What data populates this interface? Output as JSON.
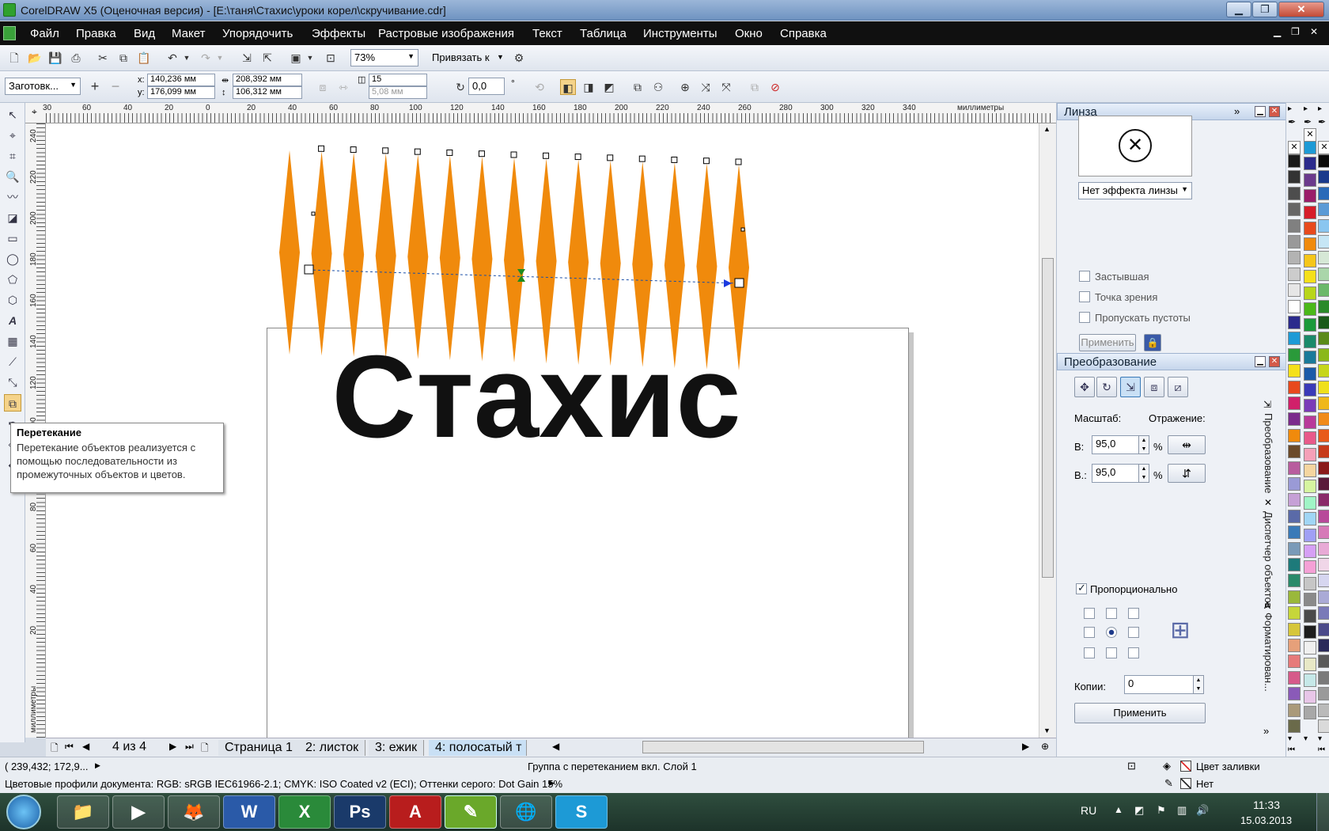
{
  "window": {
    "title": "CorelDRAW X5 (Оценочная версия) - [E:\\таня\\Стахис\\уроки корел\\скручивание.cdr]",
    "min": "▁",
    "max": "❐",
    "close": "✕"
  },
  "menu": [
    "Файл",
    "Правка",
    "Вид",
    "Макет",
    "Упорядочить",
    "Эффекты",
    "Растровые изображения",
    "Текст",
    "Таблица",
    "Инструменты",
    "Окно",
    "Справка"
  ],
  "standard_toolbar": {
    "zoom": "73%",
    "snap": "Привязать к"
  },
  "property_bar": {
    "preset": "Заготовк...",
    "x_label": "x:",
    "x": "140,236 мм",
    "y_label": "y:",
    "y": "176,099 мм",
    "w": "208,392 мм",
    "h": "106,312 мм",
    "steps": "15",
    "spacing": "5,08 мм",
    "angle": "0,0",
    "deg": "°"
  },
  "ruler_top_labels": [
    "30",
    "60",
    "40",
    "20",
    "0",
    "20",
    "40",
    "60",
    "80",
    "100",
    "120",
    "140",
    "160",
    "180",
    "200",
    "220",
    "240",
    "260",
    "280",
    "300",
    "320",
    "340",
    "миллиметры"
  ],
  "ruler_left_labels": [
    "240",
    "220",
    "200",
    "180",
    "160",
    "140",
    "120",
    "100",
    "80",
    "60",
    "40",
    "20",
    "миллиметры"
  ],
  "canvas": {
    "text": "Стахис",
    "fill": "#f08a0c",
    "text_color": "#111111"
  },
  "tooltip": {
    "title": "Перетекание",
    "body": "Перетекание объектов реализуется с помощью последовательности из промежуточных объектов и цветов."
  },
  "pages": {
    "counter": "4 из 4",
    "tabs": [
      "Страница 1",
      "2: листок",
      "3: ежик",
      "4: полосатый т"
    ]
  },
  "status": {
    "coords": "( 239,432; 172,9...",
    "object": "Группа с перетеканием вкл. Слой 1",
    "profiles": "Цветовые профили документа: RGB: sRGB IEC61966-2.1; CMYK: ISO Coated v2 (ECI); Оттенки серого: Dot Gain 15%",
    "fill_label": "Цвет заливки",
    "outline_label": "Нет"
  },
  "lens_docker": {
    "title": "Линза",
    "effect": "Нет эффекта линзы",
    "frozen": "Застывшая",
    "viewpoint": "Точка зрения",
    "remove_face": "Пропускать пустоты",
    "apply": "Применить"
  },
  "transform_docker": {
    "title": "Преобразование",
    "scale_label": "Масштаб:",
    "mirror_label": "Отражение:",
    "h_label": "В:",
    "h": "95,0",
    "v_label": "В.:",
    "v": "95,0",
    "pct": "%",
    "proportional": "Пропорционально",
    "copies_label": "Копии:",
    "copies": "0",
    "apply": "Применить"
  },
  "vertical_tabs": [
    "Преобразование",
    "Диспетчер объектов",
    "Форматирован..."
  ],
  "palette": {
    "col1": [
      "#1a1a1a",
      "#333333",
      "#4d4d4d",
      "#666666",
      "#808080",
      "#999999",
      "#b3b3b3",
      "#cccccc",
      "#e6e6e6",
      "#ffffff",
      "#2b2b8c",
      "#1d9ad6",
      "#2a9a3a",
      "#f5e01a",
      "#e8491d",
      "#d1206a",
      "#7b2b8c",
      "#f08a0c",
      "#6b4a2a",
      "#b85c9e",
      "#9a9ad6",
      "#c6a0d6",
      "#5a6aa8",
      "#3a7ab8",
      "#7a9ab8",
      "#1d7a7a",
      "#2a8a6a",
      "#9ab83a",
      "#c6d63a",
      "#d6c63a",
      "#e6a07a",
      "#e67a7a",
      "#d65a8a",
      "#8a5ab8",
      "#aa9a7a",
      "#6a6a4a"
    ],
    "col2": [
      "#1d9ad6",
      "#2b2b8c",
      "#6a3a8c",
      "#9a1d6a",
      "#d61d2a",
      "#e84a1d",
      "#f08a0c",
      "#f5c61a",
      "#f5e01a",
      "#b8d61a",
      "#4ab81a",
      "#1a9a3a",
      "#1a8a6a",
      "#1a7a9a",
      "#1a5aa8",
      "#3a3ab8",
      "#7a3ab8",
      "#b83a9a",
      "#e85a8a",
      "#f5a0b8",
      "#f5d6a0",
      "#d6f5a0",
      "#a0f5c6",
      "#a0d6f5",
      "#a0a0f5",
      "#d6a0f5",
      "#f5a0d6",
      "#c6c6c6",
      "#8a8a8a",
      "#4a4a4a",
      "#1d1d1d",
      "#f0f0f0",
      "#e8e8c6",
      "#c6e8e8",
      "#e8c6e8",
      "#a8a8a8"
    ],
    "col3": [
      "#0a0a0a",
      "#1a3a8c",
      "#2a6ab8",
      "#5a9ad6",
      "#8ac6f0",
      "#c6e6f5",
      "#d6e8d6",
      "#aad6aa",
      "#6ab86a",
      "#2a8a2a",
      "#1a5a1a",
      "#5a8a1a",
      "#8ab81a",
      "#c6d61a",
      "#f0e01a",
      "#f0b81a",
      "#f08a1a",
      "#e85a1a",
      "#c63a1a",
      "#8a1a1a",
      "#5a1a3a",
      "#8a2a6a",
      "#b84a9a",
      "#d67ab8",
      "#e8aad6",
      "#f0d6e8",
      "#d6d6f0",
      "#aaaad6",
      "#7a7ab8",
      "#4a4a8a",
      "#2a2a5a",
      "#5a5a5a",
      "#7a7a7a",
      "#9a9a9a",
      "#bababa",
      "#dadada"
    ]
  },
  "taskbar": {
    "lang": "RU",
    "time": "11:33",
    "date": "15.03.2013",
    "apps": [
      "📁",
      "▶",
      "🦊",
      "W",
      "X",
      "Ps",
      "A",
      "✎",
      "🌐",
      "S"
    ]
  }
}
